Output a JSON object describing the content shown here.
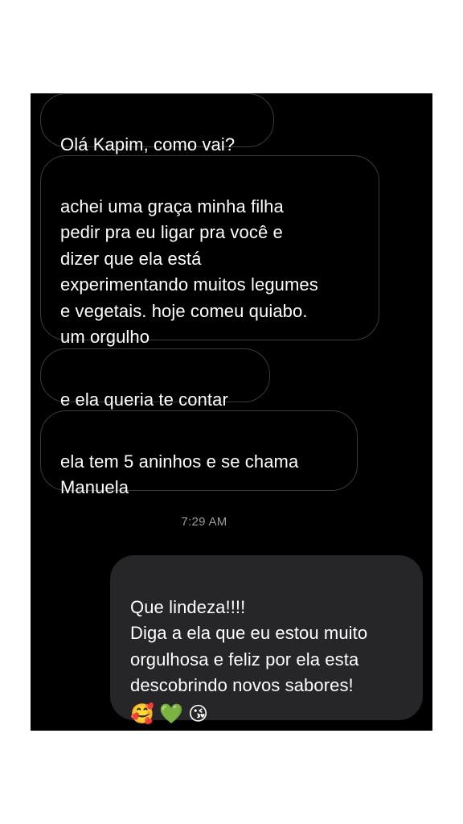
{
  "conversation": {
    "messages": [
      {
        "direction": "incoming",
        "text": "Olá Kapim, como vai?"
      },
      {
        "direction": "incoming",
        "text": "achei uma graça minha filha\npedir pra eu ligar pra você  e\ndizer que ela está\nexperimentando muitos legumes\ne vegetais.  hoje comeu quiabo.\num orgulho"
      },
      {
        "direction": "incoming",
        "text": "e ela queria te contar"
      },
      {
        "direction": "incoming",
        "text": "ela tem 5 aninhos e se chama\nManuela"
      },
      {
        "direction": "outgoing",
        "text": "Que lindeza!!!!\nDiga a ela que eu estou muito\norgulhosa e feliz por ela esta\ndescobrindo novos sabores!",
        "emojis": [
          "🥰",
          "💚",
          "😘"
        ]
      }
    ],
    "timestamp": "7:29 AM"
  }
}
